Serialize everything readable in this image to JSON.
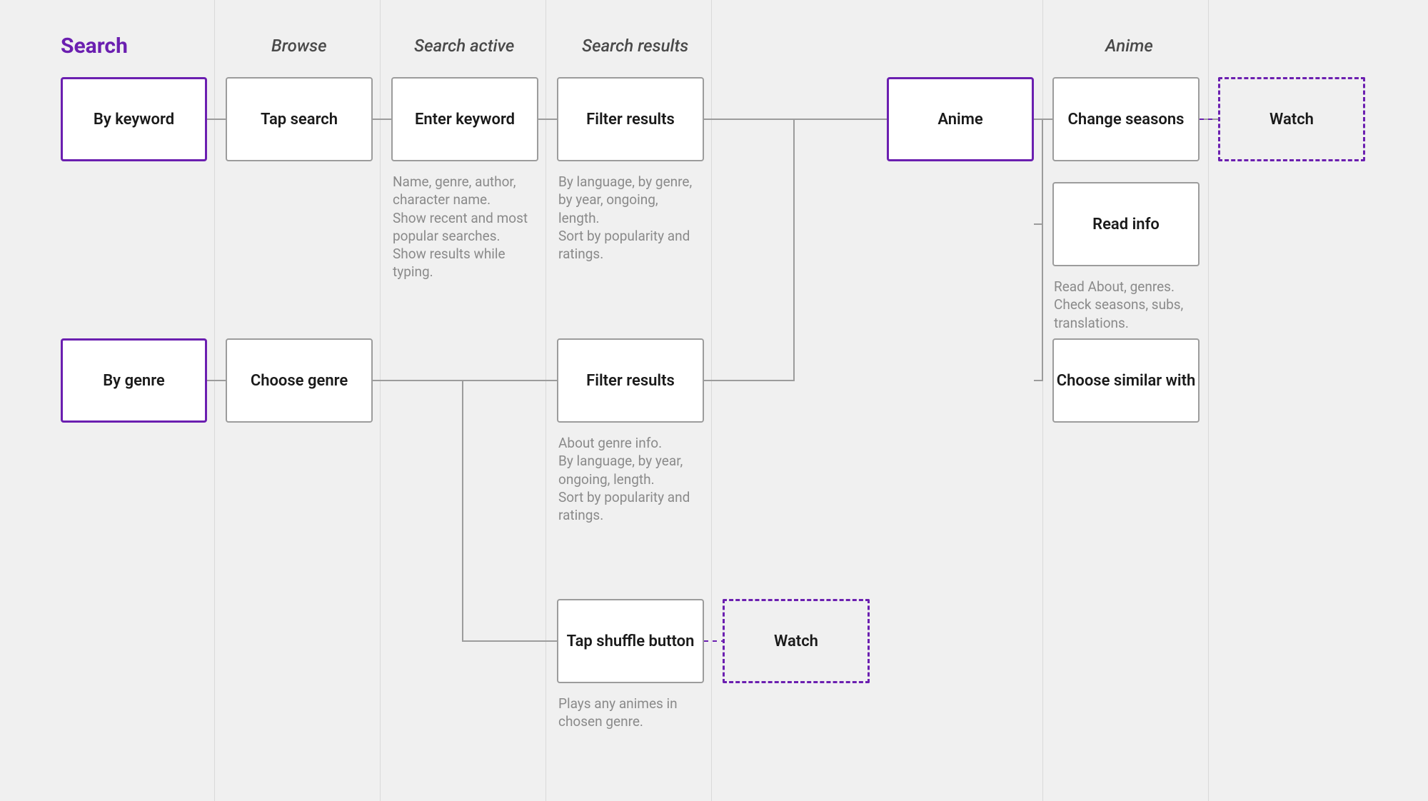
{
  "colors": {
    "accent": "#6b1fb0",
    "line": "#9c9c9c",
    "text_muted": "#8a8a8a"
  },
  "headers": {
    "root": "Search",
    "browse": "Browse",
    "active": "Search active",
    "results": "Search results",
    "anime": "Anime"
  },
  "nodes": {
    "by_keyword": "By keyword",
    "by_genre": "By genre",
    "tap_search": "Tap search",
    "choose_genre": "Choose genre",
    "enter_keyword": "Enter keyword",
    "filter_results1": "Filter results",
    "filter_results2": "Filter results",
    "tap_shuffle": "Tap shuffle button",
    "watch_shuffle": "Watch",
    "anime": "Anime",
    "change_seasons": "Change seasons",
    "read_info": "Read info",
    "choose_similar": "Choose similar with",
    "watch_final": "Watch"
  },
  "captions": {
    "enter_keyword": "Name, genre, author, character name.\nShow recent and most popular searches.\nShow results while typing.",
    "filter_results1": "By language, by genre, by year, ongoing, length.\nSort by popularity and ratings.",
    "filter_results2": "About genre info.\nBy language, by year, ongoing, length.\nSort by popularity and ratings.",
    "tap_shuffle": "Plays any animes in chosen genre.",
    "read_info": "Read About, genres.\nCheck seasons, subs, translations."
  }
}
